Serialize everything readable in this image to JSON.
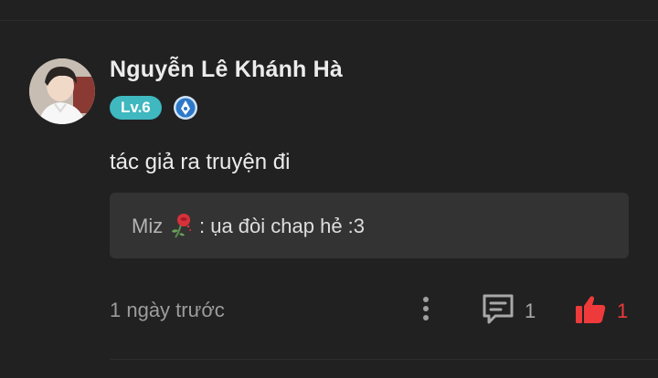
{
  "comment": {
    "author": {
      "name": "Nguyễn Lê Khánh Hà",
      "level": "Lv.6"
    },
    "text": "tác giả ra truyện đi",
    "reply_preview": {
      "author": "Miz",
      "text": ": ụa đòi chap hẻ :3"
    },
    "timestamp": "1 ngày trước",
    "reply_count": "1",
    "like_count": "1"
  },
  "icons": {
    "rank": "rank-badge-icon",
    "author_decoration": "rose-icon",
    "more": "more-vertical-icon",
    "reply": "comment-icon",
    "like": "thumbs-up-icon"
  },
  "colors": {
    "background": "#212121",
    "level_badge": "#3fb8c0",
    "reply_box": "#333333",
    "like": "#ee3a3a"
  }
}
